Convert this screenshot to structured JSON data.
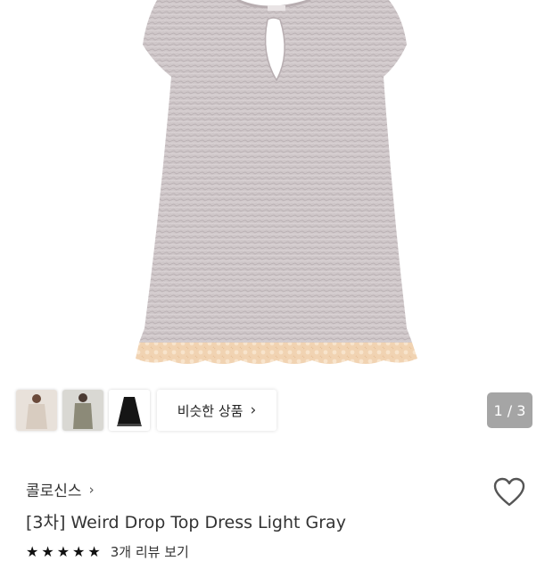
{
  "product": {
    "image_alt": "Weird Drop Top Dress Light Gray product photo",
    "similar_label": "비슷한 상품",
    "similar_chevron": "›",
    "page_indicator": "1 / 3",
    "brand": "콜로신스",
    "brand_chevron": "›",
    "title": "[3차] Weird Drop Top Dress Light Gray",
    "stars": "★★★★★",
    "review_link": "3개 리뷰 보기"
  },
  "colors": {
    "dress": "#cfc7c9",
    "lace_trim": "#f1d3b2",
    "indicator_bg": "#a5a5a5"
  },
  "thumbnails": [
    "thumbnail-beige-dress",
    "thumbnail-olive-dress",
    "thumbnail-black-dress"
  ]
}
